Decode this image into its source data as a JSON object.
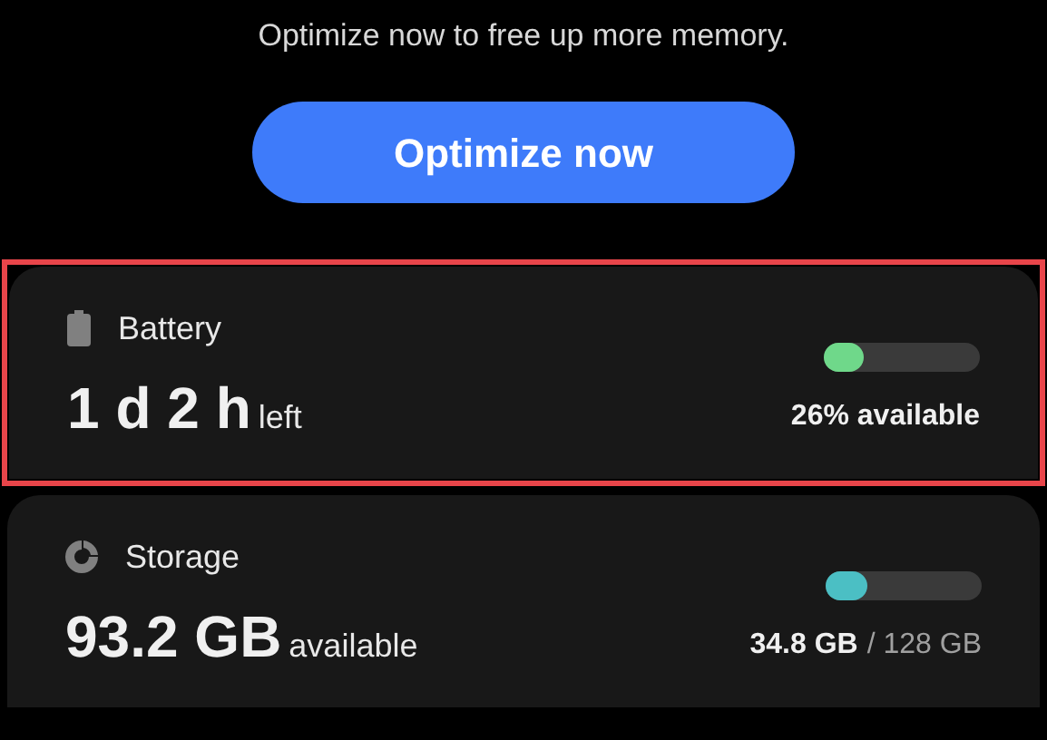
{
  "prompt": "Optimize now to free up more memory.",
  "button": {
    "label": "Optimize now"
  },
  "cards": [
    {
      "kind": "battery",
      "title": "Battery",
      "value": "1 d 2 h",
      "unit": "left",
      "level": 0.26,
      "color": "#6fd88a",
      "reading": "26% available",
      "highlighted": true
    },
    {
      "kind": "storage",
      "title": "Storage",
      "value": "93.2 GB",
      "unit": "available",
      "level": 0.27,
      "color": "#4bbfc4",
      "used": "34.8 GB",
      "total": "/ 128 GB",
      "highlighted": false
    }
  ]
}
